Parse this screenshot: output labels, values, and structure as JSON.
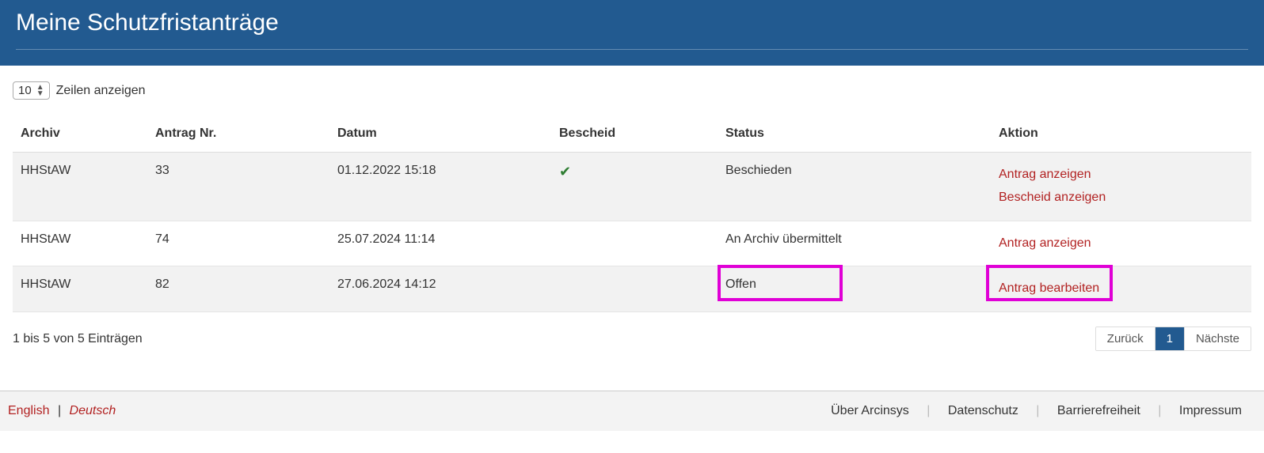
{
  "header": {
    "title": "Meine Schutzfristanträge"
  },
  "table": {
    "page_size": "10",
    "rows_label": "Zeilen anzeigen",
    "columns": {
      "archiv": "Archiv",
      "antrag_nr": "Antrag Nr.",
      "datum": "Datum",
      "bescheid": "Bescheid",
      "status": "Status",
      "aktion": "Aktion"
    },
    "rows": [
      {
        "archiv": "HHStAW",
        "antrag_nr": "33",
        "datum": "01.12.2022 15:18",
        "bescheid_icon": "check",
        "status": "Beschieden",
        "actions": [
          "Antrag anzeigen",
          "Bescheid anzeigen"
        ],
        "highlight_status": false,
        "highlight_action": false
      },
      {
        "archiv": "HHStAW",
        "antrag_nr": "74",
        "datum": "25.07.2024 11:14",
        "bescheid_icon": "",
        "status": "An Archiv übermittelt",
        "actions": [
          "Antrag anzeigen"
        ],
        "highlight_status": false,
        "highlight_action": false
      },
      {
        "archiv": "HHStAW",
        "antrag_nr": "82",
        "datum": "27.06.2024 14:12",
        "bescheid_icon": "",
        "status": "Offen",
        "actions": [
          "Antrag bearbeiten"
        ],
        "highlight_status": true,
        "highlight_action": true
      }
    ],
    "range_info": "1 bis 5 von 5 Einträgen",
    "pagination": {
      "prev": "Zurück",
      "page": "1",
      "next": "Nächste"
    }
  },
  "footer": {
    "lang_en": "English",
    "lang_de": "Deutsch",
    "links": {
      "about": "Über Arcinsys",
      "privacy": "Datenschutz",
      "accessibility": "Barrierefreiheit",
      "imprint": "Impressum"
    }
  }
}
